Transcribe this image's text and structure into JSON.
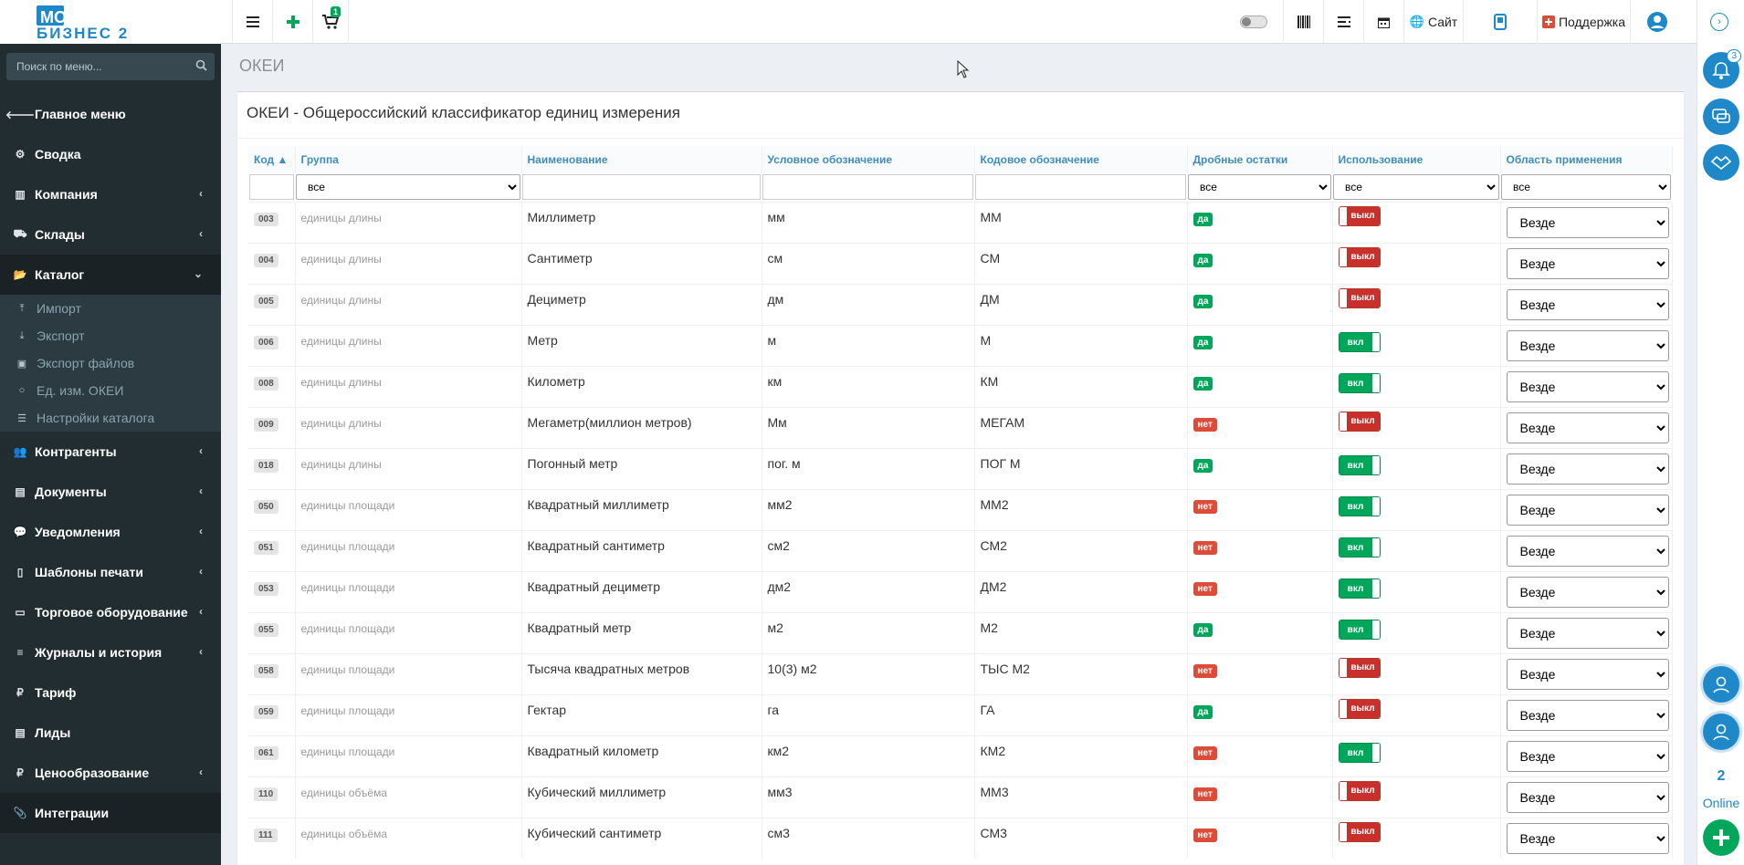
{
  "logo": {
    "line1": "МОЙ",
    "line2": "БИЗНЕС 2"
  },
  "topbar": {
    "cart_count": "1",
    "site_label": "Сайт",
    "support_label": "Поддержка"
  },
  "rightrail": {
    "notifications_count": "3",
    "online_count": "2",
    "online_label": "Online"
  },
  "sidebar": {
    "search_placeholder": "Поиск по меню...",
    "items": [
      {
        "label": "Главное меню"
      },
      {
        "label": "Сводка"
      },
      {
        "label": "Компания"
      },
      {
        "label": "Склады"
      },
      {
        "label": "Каталог"
      },
      {
        "label": "Контрагенты"
      },
      {
        "label": "Документы"
      },
      {
        "label": "Уведомления"
      },
      {
        "label": "Шаблоны печати"
      },
      {
        "label": "Торговое оборудование"
      },
      {
        "label": "Журналы и история"
      },
      {
        "label": "Тариф"
      },
      {
        "label": "Лиды"
      },
      {
        "label": "Ценообразование"
      },
      {
        "label": "Интеграции"
      }
    ],
    "catalog_sub": [
      {
        "label": "Импорт"
      },
      {
        "label": "Экспорт"
      },
      {
        "label": "Экспорт файлов"
      },
      {
        "label": "Ед. изм. ОКЕИ"
      },
      {
        "label": "Настройки каталога"
      }
    ]
  },
  "page": {
    "header": "ОКЕИ",
    "box_title": "ОКЕИ - Общероссийский классификатор единиц измерения"
  },
  "table": {
    "columns": [
      {
        "label": "Код ▲"
      },
      {
        "label": "Группа"
      },
      {
        "label": "Наименование"
      },
      {
        "label": "Условное обозначение"
      },
      {
        "label": "Кодовое обозначение"
      },
      {
        "label": "Дробные остатки"
      },
      {
        "label": "Использование"
      },
      {
        "label": "Область применения"
      }
    ],
    "filters": {
      "group": "все",
      "fractional": "все",
      "usage": "все",
      "area": "все"
    },
    "rows": [
      {
        "code": "003",
        "group": "единицы длины",
        "name": "Миллиметр",
        "symbol": "мм",
        "codesym": "ММ",
        "fractional": "да",
        "usage": "выкл",
        "area": "Везде"
      },
      {
        "code": "004",
        "group": "единицы длины",
        "name": "Сантиметр",
        "symbol": "см",
        "codesym": "СМ",
        "fractional": "да",
        "usage": "выкл",
        "area": "Везде"
      },
      {
        "code": "005",
        "group": "единицы длины",
        "name": "Дециметр",
        "symbol": "дм",
        "codesym": "ДМ",
        "fractional": "да",
        "usage": "выкл",
        "area": "Везде"
      },
      {
        "code": "006",
        "group": "единицы длины",
        "name": "Метр",
        "symbol": "м",
        "codesym": "М",
        "fractional": "да",
        "usage": "вкл",
        "area": "Везде"
      },
      {
        "code": "008",
        "group": "единицы длины",
        "name": "Километр",
        "symbol": "км",
        "codesym": "КМ",
        "fractional": "да",
        "usage": "вкл",
        "area": "Везде"
      },
      {
        "code": "009",
        "group": "единицы длины",
        "name": "Мегаметр(миллион метров)",
        "symbol": "Мм",
        "codesym": "МЕГАМ",
        "fractional": "нет",
        "usage": "выкл",
        "area": "Везде"
      },
      {
        "code": "018",
        "group": "единицы длины",
        "name": "Погонный метр",
        "symbol": "пог. м",
        "codesym": "ПОГ М",
        "fractional": "да",
        "usage": "вкл",
        "area": "Везде"
      },
      {
        "code": "050",
        "group": "единицы площади",
        "name": "Квадратный миллиметр",
        "symbol": "мм2",
        "codesym": "ММ2",
        "fractional": "нет",
        "usage": "вкл",
        "area": "Везде"
      },
      {
        "code": "051",
        "group": "единицы площади",
        "name": "Квадратный сантиметр",
        "symbol": "см2",
        "codesym": "СМ2",
        "fractional": "нет",
        "usage": "вкл",
        "area": "Везде"
      },
      {
        "code": "053",
        "group": "единицы площади",
        "name": "Квадратный дециметр",
        "symbol": "дм2",
        "codesym": "ДМ2",
        "fractional": "нет",
        "usage": "вкл",
        "area": "Везде"
      },
      {
        "code": "055",
        "group": "единицы площади",
        "name": "Квадратный метр",
        "symbol": "м2",
        "codesym": "М2",
        "fractional": "да",
        "usage": "вкл",
        "area": "Везде"
      },
      {
        "code": "058",
        "group": "единицы площади",
        "name": "Тысяча квадратных метров",
        "symbol": "10(3) м2",
        "codesym": "ТЫС М2",
        "fractional": "нет",
        "usage": "выкл",
        "area": "Везде"
      },
      {
        "code": "059",
        "group": "единицы площади",
        "name": "Гектар",
        "symbol": "га",
        "codesym": "ГА",
        "fractional": "да",
        "usage": "выкл",
        "area": "Везде"
      },
      {
        "code": "061",
        "group": "единицы площади",
        "name": "Квадратный километр",
        "symbol": "км2",
        "codesym": "КМ2",
        "fractional": "нет",
        "usage": "вкл",
        "area": "Везде"
      },
      {
        "code": "110",
        "group": "единицы объёма",
        "name": "Кубический миллиметр",
        "symbol": "мм3",
        "codesym": "ММ3",
        "fractional": "нет",
        "usage": "выкл",
        "area": "Везде"
      },
      {
        "code": "111",
        "group": "единицы объёма",
        "name": "Кубический сантиметр",
        "symbol": "см3",
        "codesym": "СМ3",
        "fractional": "нет",
        "usage": "выкл",
        "area": "Везде"
      }
    ]
  },
  "colors": {
    "sidebar_bg": "#222d32",
    "accent_blue": "#3c8dbc",
    "success": "#00a65a",
    "danger": "#dd4b39"
  }
}
